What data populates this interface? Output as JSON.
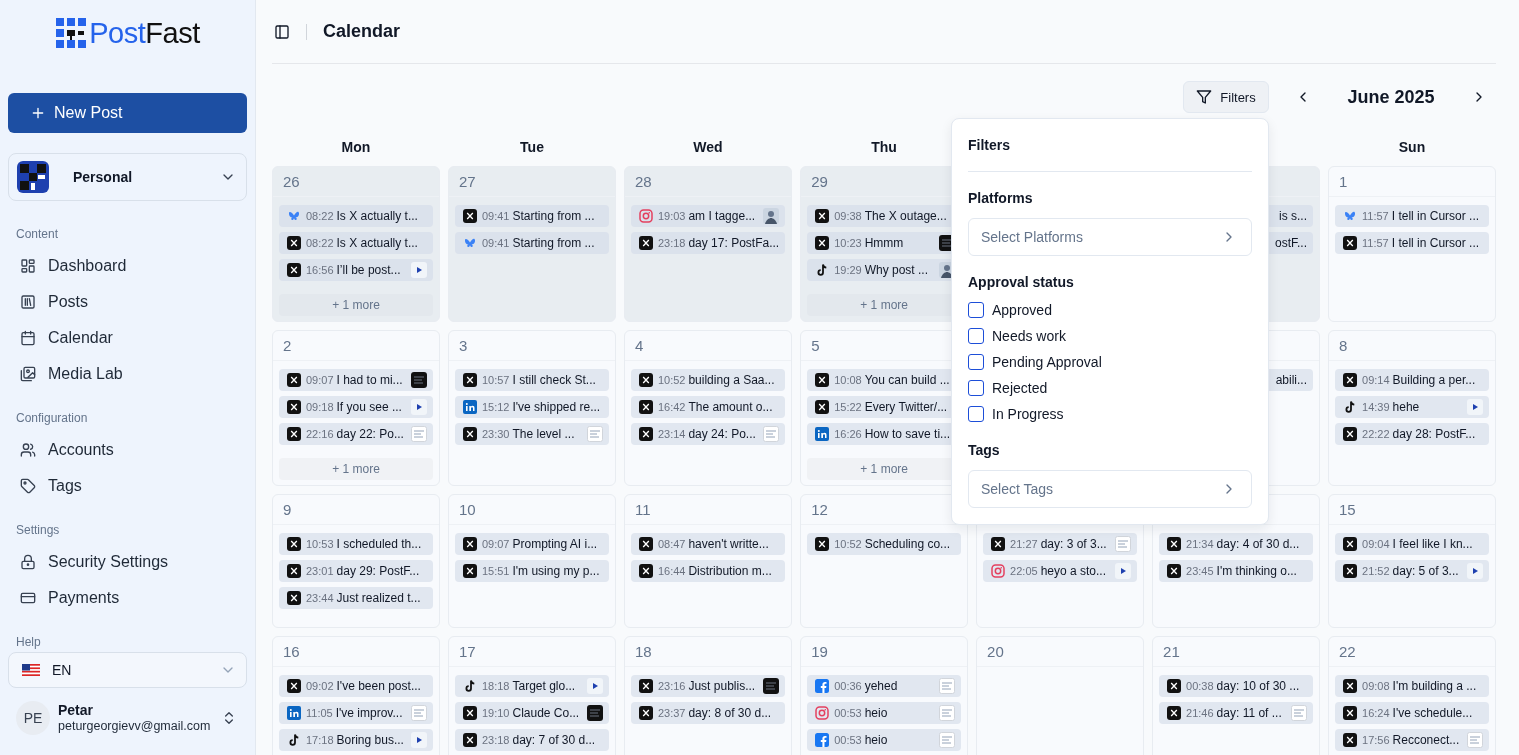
{
  "sidebar": {
    "logo": {
      "accent": "Post",
      "rest": "Fast"
    },
    "new_post": "New Post",
    "workspace": {
      "name": "Personal"
    },
    "sections": [
      {
        "title": "Content",
        "items": [
          {
            "label": "Dashboard"
          },
          {
            "label": "Posts"
          },
          {
            "label": "Calendar"
          },
          {
            "label": "Media Lab"
          }
        ]
      },
      {
        "title": "Configuration",
        "items": [
          {
            "label": "Accounts"
          },
          {
            "label": "Tags"
          }
        ]
      },
      {
        "title": "Settings",
        "items": [
          {
            "label": "Security Settings"
          },
          {
            "label": "Payments"
          }
        ]
      },
      {
        "title": "Help"
      }
    ],
    "language": {
      "code": "EN"
    },
    "user": {
      "initials": "PE",
      "name": "Petar",
      "email": "peturgeorgievv@gmail.com"
    }
  },
  "header": {
    "title": "Calendar"
  },
  "toolbar": {
    "filters": "Filters",
    "month": "June 2025"
  },
  "filters": {
    "title": "Filters",
    "platforms_label": "Platforms",
    "platforms": {
      "placeholder": "Select Platforms"
    },
    "status_label": "Approval status",
    "statuses": [
      {
        "label": "Approved",
        "checked": false
      },
      {
        "label": "Needs work",
        "checked": false
      },
      {
        "label": "Pending Approval",
        "checked": false
      },
      {
        "label": "Rejected",
        "checked": false
      },
      {
        "label": "In Progress",
        "checked": false
      }
    ],
    "tags_label": "Tags",
    "tags": {
      "placeholder": "Select Tags"
    }
  },
  "calendar": {
    "weekdays": [
      {
        "label": "Mon"
      },
      {
        "label": "Tue"
      },
      {
        "label": "Wed"
      },
      {
        "label": "Thu"
      },
      {
        "covered": true
      },
      {
        "covered": true
      },
      {
        "label": "Sun"
      }
    ],
    "weeks": [
      {
        "days": [
          {
            "date": "26",
            "outside": true,
            "more": "+ 1 more",
            "posts": [
              {
                "kind": "bluesky",
                "time": "08:22",
                "text": "Is X actually t..."
              },
              {
                "kind": "x",
                "time": "08:22",
                "text": "Is X actually t..."
              },
              {
                "kind": "x",
                "time": "16:56",
                "text": "I’ll be post...",
                "thumb": {
                  "kind": "video"
                }
              }
            ]
          },
          {
            "date": "27",
            "outside": true,
            "posts": [
              {
                "kind": "x",
                "time": "09:41",
                "text": "Starting from ..."
              },
              {
                "kind": "bluesky",
                "time": "09:41",
                "text": "Starting from ..."
              }
            ]
          },
          {
            "date": "28",
            "outside": true,
            "posts": [
              {
                "kind": "instagram",
                "time": "19:03",
                "text": "am I tagge...",
                "thumb": {
                  "kind": "photo"
                }
              },
              {
                "kind": "x",
                "time": "23:18",
                "text": "day 17: PostFa..."
              }
            ]
          },
          {
            "date": "29",
            "outside": true,
            "more": "+ 1 more",
            "posts": [
              {
                "kind": "x",
                "time": "09:38",
                "text": "The X outage..."
              },
              {
                "kind": "x",
                "time": "10:23",
                "text": "Hmmm",
                "thumb": {
                  "kind": "dark"
                }
              },
              {
                "kind": "tiktok",
                "time": "19:29",
                "text": "Why post ...",
                "thumb": {
                  "kind": "photo"
                }
              }
            ]
          },
          {
            "covered": true
          },
          {
            "outside": true,
            "posts": [
              {
                "kind": "partial",
                "text": "is s..."
              },
              {
                "kind": "partial",
                "text": "ostF..."
              }
            ]
          },
          {
            "date": "1",
            "outside": false,
            "posts": [
              {
                "kind": "bluesky",
                "time": "11:57",
                "text": "I tell in Cursor ..."
              },
              {
                "kind": "x",
                "time": "11:57",
                "text": "I tell in Cursor ..."
              }
            ]
          }
        ]
      },
      {
        "days": [
          {
            "date": "2",
            "outside": false,
            "more": "+ 1 more",
            "posts": [
              {
                "kind": "x",
                "time": "09:07",
                "text": "I had to mi...",
                "thumb": {
                  "kind": "dark"
                }
              },
              {
                "kind": "x",
                "time": "09:18",
                "text": "If you see ...",
                "thumb": {
                  "kind": "video"
                }
              },
              {
                "kind": "x",
                "time": "22:16",
                "text": "day 22: Po...",
                "thumb": {
                  "kind": "light"
                }
              }
            ]
          },
          {
            "date": "3",
            "outside": false,
            "posts": [
              {
                "kind": "x",
                "time": "10:57",
                "text": "I still check St..."
              },
              {
                "kind": "linkedin",
                "time": "15:12",
                "text": "I've shipped re..."
              },
              {
                "kind": "x",
                "time": "23:30",
                "text": "The level ...",
                "thumb": {
                  "kind": "light"
                }
              }
            ]
          },
          {
            "date": "4",
            "outside": false,
            "posts": [
              {
                "kind": "x",
                "time": "10:52",
                "text": "building a Saa..."
              },
              {
                "kind": "x",
                "time": "16:42",
                "text": "The amount o..."
              },
              {
                "kind": "x",
                "time": "23:14",
                "text": "day 24: Po...",
                "thumb": {
                  "kind": "light"
                }
              }
            ]
          },
          {
            "date": "5",
            "outside": false,
            "more": "+ 1 more",
            "posts": [
              {
                "kind": "x",
                "time": "10:08",
                "text": "You can build ..."
              },
              {
                "kind": "x",
                "time": "15:22",
                "text": "Every Twitter/..."
              },
              {
                "kind": "linkedin",
                "time": "16:26",
                "text": "How to save ti..."
              }
            ]
          },
          {
            "covered": true
          },
          {
            "outside": false,
            "posts": [
              {
                "kind": "partial",
                "text": "abili..."
              }
            ]
          },
          {
            "date": "8",
            "outside": false,
            "posts": [
              {
                "kind": "x",
                "time": "09:14",
                "text": "Building a per..."
              },
              {
                "kind": "tiktok",
                "time": "14:39",
                "text": "hehe",
                "thumb": {
                  "kind": "video"
                }
              },
              {
                "kind": "x",
                "time": "22:22",
                "text": "day 28: PostF..."
              }
            ]
          }
        ]
      },
      {
        "days": [
          {
            "date": "9",
            "outside": false,
            "posts": [
              {
                "kind": "x",
                "time": "10:53",
                "text": "I scheduled th..."
              },
              {
                "kind": "x",
                "time": "23:01",
                "text": "day 29: PostF..."
              },
              {
                "kind": "x",
                "time": "23:44",
                "text": "Just realized t..."
              }
            ]
          },
          {
            "date": "10",
            "outside": false,
            "posts": [
              {
                "kind": "x",
                "time": "09:07",
                "text": "Prompting AI i..."
              },
              {
                "kind": "x",
                "time": "15:51",
                "text": "I'm using my p..."
              }
            ]
          },
          {
            "date": "11",
            "outside": false,
            "posts": [
              {
                "kind": "x",
                "time": "08:47",
                "text": "haven't writte..."
              },
              {
                "kind": "x",
                "time": "16:44",
                "text": "Distribution m..."
              }
            ]
          },
          {
            "date": "12",
            "outside": false,
            "posts": [
              {
                "kind": "x",
                "time": "10:52",
                "text": "Scheduling co..."
              }
            ]
          },
          {
            "outside": false,
            "posts": [
              {
                "kind": "x",
                "time": "21:27",
                "text": "day: 3 of 3...",
                "thumb": {
                  "kind": "light"
                }
              },
              {
                "kind": "instagram",
                "time": "22:05",
                "text": "heyo a sto...",
                "thumb": {
                  "kind": "video"
                }
              }
            ]
          },
          {
            "outside": false,
            "posts": [
              {
                "kind": "x",
                "time": "21:34",
                "text": "day: 4 of 30 d..."
              },
              {
                "kind": "x",
                "time": "23:45",
                "text": "I'm thinking o..."
              }
            ]
          },
          {
            "date": "15",
            "outside": false,
            "posts": [
              {
                "kind": "x",
                "time": "09:04",
                "text": "I feel like I kn..."
              },
              {
                "kind": "x",
                "time": "21:52",
                "text": "day: 5 of 3...",
                "thumb": {
                  "kind": "video"
                }
              }
            ]
          }
        ]
      },
      {
        "days": [
          {
            "date": "16",
            "outside": false,
            "posts": [
              {
                "kind": "x",
                "time": "09:02",
                "text": "I've been post..."
              },
              {
                "kind": "linkedin",
                "time": "11:05",
                "text": "I've improv...",
                "thumb": {
                  "kind": "light"
                }
              },
              {
                "kind": "tiktok",
                "time": "17:18",
                "text": "Boring bus...",
                "thumb": {
                  "kind": "video"
                }
              }
            ]
          },
          {
            "date": "17",
            "outside": false,
            "posts": [
              {
                "kind": "tiktok",
                "time": "18:18",
                "text": "Target glo...",
                "thumb": {
                  "kind": "video"
                }
              },
              {
                "kind": "x",
                "time": "19:10",
                "text": "Claude Co...",
                "thumb": {
                  "kind": "dark"
                }
              },
              {
                "kind": "x",
                "time": "23:18",
                "text": "day: 7 of 30 d..."
              }
            ]
          },
          {
            "date": "18",
            "outside": false,
            "posts": [
              {
                "kind": "x",
                "time": "23:16",
                "text": "Just publis...",
                "thumb": {
                  "kind": "dark"
                }
              },
              {
                "kind": "x",
                "time": "23:37",
                "text": "day: 8 of 30 d..."
              }
            ]
          },
          {
            "date": "19",
            "outside": false,
            "posts": [
              {
                "kind": "facebook",
                "time": "00:36",
                "text": "yehed",
                "thumb": {
                  "kind": "light"
                }
              },
              {
                "kind": "instagram",
                "time": "00:53",
                "text": "heio",
                "thumb": {
                  "kind": "light"
                }
              },
              {
                "kind": "facebook",
                "time": "00:53",
                "text": "heio",
                "thumb": {
                  "kind": "light"
                }
              }
            ]
          },
          {
            "date": "20",
            "outside": false
          },
          {
            "date": "21",
            "outside": false,
            "posts": [
              {
                "kind": "x",
                "time": "00:38",
                "text": "day: 10 of 30 ..."
              },
              {
                "kind": "x",
                "time": "21:46",
                "text": "day: 11 of ...",
                "thumb": {
                  "kind": "light"
                }
              }
            ]
          },
          {
            "date": "22",
            "outside": false,
            "posts": [
              {
                "kind": "x",
                "time": "09:08",
                "text": "I'm building a ..."
              },
              {
                "kind": "x",
                "time": "16:24",
                "text": "I've schedule..."
              },
              {
                "kind": "x",
                "time": "17:56",
                "text": "Recconect...",
                "thumb": {
                  "kind": "light"
                }
              }
            ]
          }
        ]
      }
    ]
  }
}
